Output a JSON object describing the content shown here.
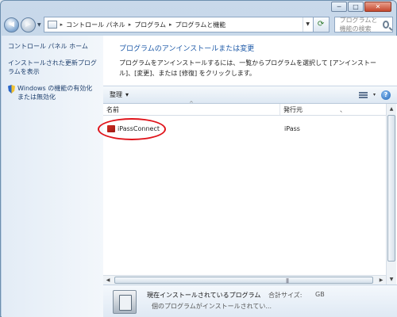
{
  "window": {
    "controls": {
      "minimize": "─",
      "maximize": "□",
      "close": "✕"
    }
  },
  "nav": {
    "breadcrumb": [
      "コントロール パネル",
      "プログラム",
      "プログラムと機能"
    ],
    "breadcrumb_separator": "▸",
    "search_placeholder": "プログラムと機能の検索"
  },
  "sidebar": {
    "items": [
      {
        "label": "コントロール パネル ホーム"
      },
      {
        "label": "インストールされた更新プログラムを表示"
      },
      {
        "label": "Windows の機能の有効化または無効化",
        "icon": "shield-icon"
      }
    ]
  },
  "main": {
    "title": "プログラムのアンインストールまたは変更",
    "description": "プログラムをアンインストールするには、一覧からプログラムを選択して [アンインストール]、[変更]、または [修復] をクリックします。"
  },
  "toolbar": {
    "organize_label": "整理",
    "dropdown_arrow": "▾",
    "help_label": "?"
  },
  "list": {
    "columns": [
      {
        "label": "名前"
      },
      {
        "label": "発行元"
      }
    ],
    "column_tick": "、",
    "sort_indicator": "^",
    "rows": [
      {
        "name": "iPassConnect",
        "publisher": "iPass",
        "icon": "ipass-app-icon"
      }
    ]
  },
  "details": {
    "title": "現在インストールされているプログラム",
    "size_label": "合計サイズ:",
    "size_unit": "GB",
    "count_text": "個のプログラムがインストールされてい..."
  },
  "colors": {
    "link": "#1e5aa8",
    "highlight": "#e0141b",
    "app_icon": "#d42a20"
  }
}
